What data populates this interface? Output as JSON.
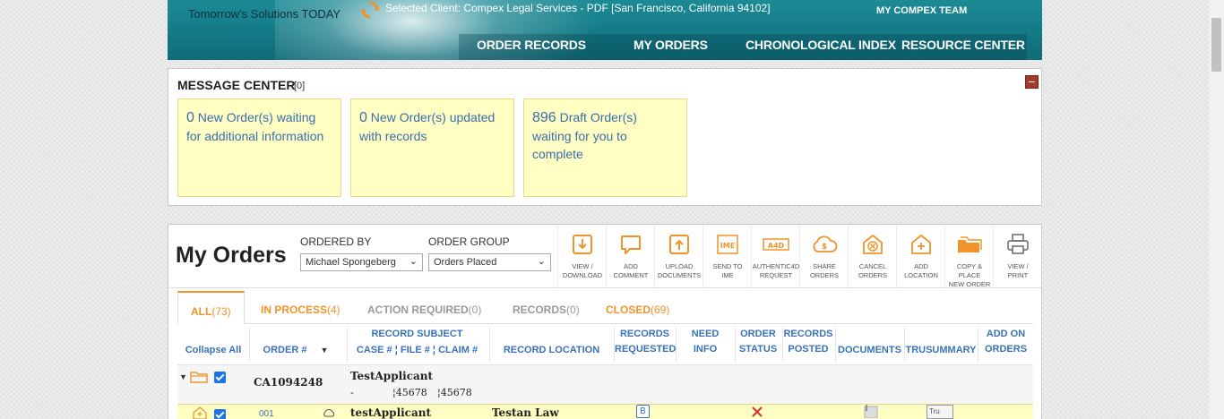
{
  "banner": {
    "tagline": "Tomorrow's Solutions TODAY",
    "selected_client": "Selected Client: Compex Legal Services - PDF [San Francisco, California 94102]",
    "team_link": "MY COMPEX TEAM",
    "nav": [
      "ORDER RECORDS",
      "MY ORDERS",
      "CHRONOLOGICAL INDEX",
      "RESOURCE CENTER"
    ]
  },
  "message_center": {
    "title": "MESSAGE CENTER",
    "count": "[0]",
    "collapse_symbol": "−",
    "cards": [
      {
        "num": "0",
        "text": "New Order(s) waiting for additional information"
      },
      {
        "num": "0",
        "text": "New Order(s) updated with records"
      },
      {
        "num": "896",
        "text": "Draft Order(s) waiting for you to complete"
      }
    ]
  },
  "orders": {
    "title": "My Orders",
    "ordered_by": {
      "label": "ORDERED BY",
      "value": "Michael Spongeberg"
    },
    "order_group": {
      "label": "ORDER GROUP",
      "value": "Orders Placed"
    },
    "tools": [
      {
        "icon": "download-icon",
        "label1": "VIEW /",
        "label2": "DOWNLOAD"
      },
      {
        "icon": "comment-icon",
        "label1": "ADD",
        "label2": "COMMENT"
      },
      {
        "icon": "upload-icon",
        "label1": "UPLOAD",
        "label2": "DOCUMENTS"
      },
      {
        "icon": "ime-icon",
        "label1": "SEND TO",
        "label2": "IME"
      },
      {
        "icon": "a4d-icon",
        "label1": "AUTHENTIC4D",
        "label2": "REQUEST"
      },
      {
        "icon": "share-cloud-icon",
        "label1": "SHARE",
        "label2": "ORDERS"
      },
      {
        "icon": "cancel-order-icon",
        "label1": "CANCEL",
        "label2": "ORDERS"
      },
      {
        "icon": "add-location-icon",
        "label1": "ADD",
        "label2": "LOCATION"
      },
      {
        "icon": "copy-folder-icon",
        "label1": "COPY & PLACE",
        "label2": "NEW ORDER"
      },
      {
        "icon": "print-icon",
        "label1": "VIEW /",
        "label2": "PRINT"
      }
    ],
    "tabs": [
      {
        "label": "ALL",
        "count": "(73)"
      },
      {
        "label": "IN PROCESS",
        "count": "(4)"
      },
      {
        "label": "ACTION REQUIRED",
        "count": "(0)"
      },
      {
        "label": "RECORDS",
        "count": "(0)"
      },
      {
        "label": "CLOSED",
        "count": "(69)"
      }
    ],
    "columns": {
      "collapse_all": "Collapse All",
      "order_no": "ORDER #",
      "record_subject": "RECORD SUBJECT",
      "case_no": "CASE #",
      "file_no": "FILE #",
      "claim_no": "CLAIM #",
      "record_location": "RECORD LOCATION",
      "records_requested_1": "RECORDS",
      "records_requested_2": "REQUESTED",
      "need_info_1": "NEED",
      "need_info_2": "INFO",
      "order_status_1": "ORDER",
      "order_status_2": "STATUS",
      "records_posted_1": "RECORDS",
      "records_posted_2": "POSTED",
      "documents": "DOCUMENTS",
      "trusummary": "TRUSUMMARY",
      "add_on_1": "ADD ON",
      "add_on_2": "ORDERS"
    },
    "group_row": {
      "order_id": "CA1094248",
      "subject": "TestApplicant",
      "case": "-",
      "file": "45678",
      "claim": "45678"
    },
    "sub_row": {
      "order_no": "001",
      "subject": "testApplicant",
      "location": "Testan Law",
      "records_badge": "B",
      "trusummary_badge": "Tru"
    }
  },
  "colors": {
    "accent_orange": "#f0932b",
    "link_blue": "#3a72b8",
    "banner_teal": "#137a86",
    "note_yellow": "#ffffc4"
  }
}
